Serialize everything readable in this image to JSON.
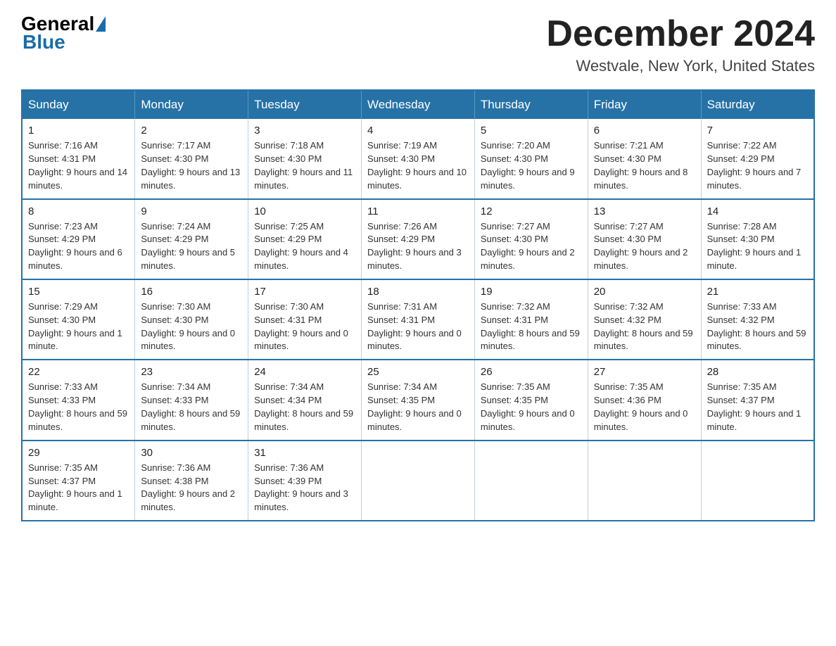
{
  "logo": {
    "text_general": "General",
    "triangle_char": "▶",
    "text_blue": "Blue"
  },
  "header": {
    "month": "December 2024",
    "location": "Westvale, New York, United States"
  },
  "days_of_week": [
    "Sunday",
    "Monday",
    "Tuesday",
    "Wednesday",
    "Thursday",
    "Friday",
    "Saturday"
  ],
  "weeks": [
    [
      {
        "day": "1",
        "sunrise": "7:16 AM",
        "sunset": "4:31 PM",
        "daylight": "9 hours and 14 minutes."
      },
      {
        "day": "2",
        "sunrise": "7:17 AM",
        "sunset": "4:30 PM",
        "daylight": "9 hours and 13 minutes."
      },
      {
        "day": "3",
        "sunrise": "7:18 AM",
        "sunset": "4:30 PM",
        "daylight": "9 hours and 11 minutes."
      },
      {
        "day": "4",
        "sunrise": "7:19 AM",
        "sunset": "4:30 PM",
        "daylight": "9 hours and 10 minutes."
      },
      {
        "day": "5",
        "sunrise": "7:20 AM",
        "sunset": "4:30 PM",
        "daylight": "9 hours and 9 minutes."
      },
      {
        "day": "6",
        "sunrise": "7:21 AM",
        "sunset": "4:30 PM",
        "daylight": "9 hours and 8 minutes."
      },
      {
        "day": "7",
        "sunrise": "7:22 AM",
        "sunset": "4:29 PM",
        "daylight": "9 hours and 7 minutes."
      }
    ],
    [
      {
        "day": "8",
        "sunrise": "7:23 AM",
        "sunset": "4:29 PM",
        "daylight": "9 hours and 6 minutes."
      },
      {
        "day": "9",
        "sunrise": "7:24 AM",
        "sunset": "4:29 PM",
        "daylight": "9 hours and 5 minutes."
      },
      {
        "day": "10",
        "sunrise": "7:25 AM",
        "sunset": "4:29 PM",
        "daylight": "9 hours and 4 minutes."
      },
      {
        "day": "11",
        "sunrise": "7:26 AM",
        "sunset": "4:29 PM",
        "daylight": "9 hours and 3 minutes."
      },
      {
        "day": "12",
        "sunrise": "7:27 AM",
        "sunset": "4:30 PM",
        "daylight": "9 hours and 2 minutes."
      },
      {
        "day": "13",
        "sunrise": "7:27 AM",
        "sunset": "4:30 PM",
        "daylight": "9 hours and 2 minutes."
      },
      {
        "day": "14",
        "sunrise": "7:28 AM",
        "sunset": "4:30 PM",
        "daylight": "9 hours and 1 minute."
      }
    ],
    [
      {
        "day": "15",
        "sunrise": "7:29 AM",
        "sunset": "4:30 PM",
        "daylight": "9 hours and 1 minute."
      },
      {
        "day": "16",
        "sunrise": "7:30 AM",
        "sunset": "4:30 PM",
        "daylight": "9 hours and 0 minutes."
      },
      {
        "day": "17",
        "sunrise": "7:30 AM",
        "sunset": "4:31 PM",
        "daylight": "9 hours and 0 minutes."
      },
      {
        "day": "18",
        "sunrise": "7:31 AM",
        "sunset": "4:31 PM",
        "daylight": "9 hours and 0 minutes."
      },
      {
        "day": "19",
        "sunrise": "7:32 AM",
        "sunset": "4:31 PM",
        "daylight": "8 hours and 59 minutes."
      },
      {
        "day": "20",
        "sunrise": "7:32 AM",
        "sunset": "4:32 PM",
        "daylight": "8 hours and 59 minutes."
      },
      {
        "day": "21",
        "sunrise": "7:33 AM",
        "sunset": "4:32 PM",
        "daylight": "8 hours and 59 minutes."
      }
    ],
    [
      {
        "day": "22",
        "sunrise": "7:33 AM",
        "sunset": "4:33 PM",
        "daylight": "8 hours and 59 minutes."
      },
      {
        "day": "23",
        "sunrise": "7:34 AM",
        "sunset": "4:33 PM",
        "daylight": "8 hours and 59 minutes."
      },
      {
        "day": "24",
        "sunrise": "7:34 AM",
        "sunset": "4:34 PM",
        "daylight": "8 hours and 59 minutes."
      },
      {
        "day": "25",
        "sunrise": "7:34 AM",
        "sunset": "4:35 PM",
        "daylight": "9 hours and 0 minutes."
      },
      {
        "day": "26",
        "sunrise": "7:35 AM",
        "sunset": "4:35 PM",
        "daylight": "9 hours and 0 minutes."
      },
      {
        "day": "27",
        "sunrise": "7:35 AM",
        "sunset": "4:36 PM",
        "daylight": "9 hours and 0 minutes."
      },
      {
        "day": "28",
        "sunrise": "7:35 AM",
        "sunset": "4:37 PM",
        "daylight": "9 hours and 1 minute."
      }
    ],
    [
      {
        "day": "29",
        "sunrise": "7:35 AM",
        "sunset": "4:37 PM",
        "daylight": "9 hours and 1 minute."
      },
      {
        "day": "30",
        "sunrise": "7:36 AM",
        "sunset": "4:38 PM",
        "daylight": "9 hours and 2 minutes."
      },
      {
        "day": "31",
        "sunrise": "7:36 AM",
        "sunset": "4:39 PM",
        "daylight": "9 hours and 3 minutes."
      },
      null,
      null,
      null,
      null
    ]
  ]
}
